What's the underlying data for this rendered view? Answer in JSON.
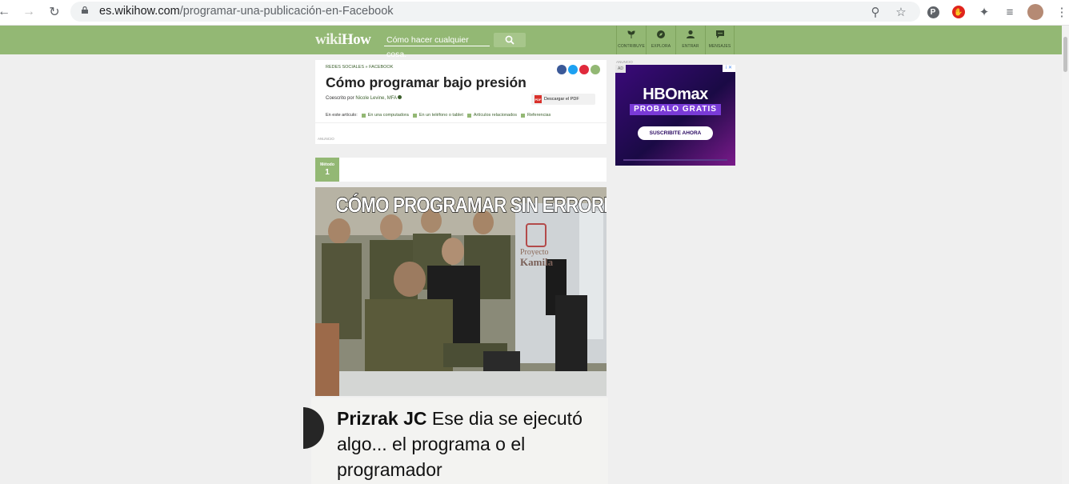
{
  "browser": {
    "url_host": "es.wikihow.com",
    "url_path": "/programar-una-publicación-en-Facebook"
  },
  "site": {
    "logo_wiki": "wiki",
    "logo_how": "How",
    "search_placeholder": "Cómo hacer cualquier cosa.",
    "nav": [
      {
        "label": "CONTRIBUYE",
        "icon": "sprout-icon"
      },
      {
        "label": "EXPLORA",
        "icon": "compass-icon"
      },
      {
        "label": "ENTRAR",
        "icon": "user-icon"
      },
      {
        "label": "MENSAJES",
        "icon": "chat-icon"
      }
    ],
    "colors": {
      "brand_green": "#93b874",
      "link_green": "#3b5f2c"
    }
  },
  "article": {
    "breadcrumb": [
      "REDES SOCIALES",
      "FACEBOOK"
    ],
    "breadcrumb_sep": "»",
    "title": "Cómo programar bajo presión",
    "coauthor_prefix": "Coescrito por",
    "coauthor_name": "Nicole Levine, MFA",
    "pdf_label": "Descargar el PDF",
    "pdf_badge": "PDF",
    "toc_label": "En este artículo:",
    "toc_items": [
      "En una computadora",
      "En un teléfono o tablet",
      "Artículos relacionados",
      "Referencias"
    ],
    "ad_label": "ANUNCIO",
    "method_label": "Método",
    "method_number": "1"
  },
  "meme": {
    "caption": "CÓMO PROGRAMAR SIN ERRORES",
    "watermark_top": "Proyecto",
    "watermark_name": "Kamila",
    "comment_author": "Prizrak JC",
    "comment_text": " Ese dia se ejecutó algo... el programa o el programador"
  },
  "ad": {
    "label": "ANUNCIO",
    "tag": "AD",
    "brand": "HBOmax",
    "headline": "PROBALO GRATIS",
    "cta": "SUSCRIBITE AHORA",
    "close": "i ✕"
  }
}
